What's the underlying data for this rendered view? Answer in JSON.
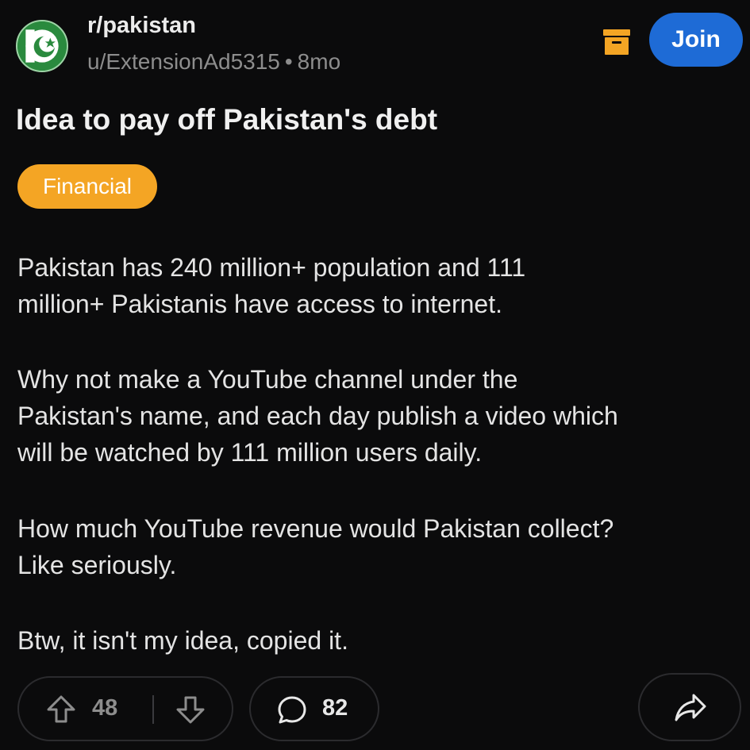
{
  "header": {
    "subreddit": "r/pakistan",
    "author": "u/ExtensionAd5315",
    "separator": "•",
    "age": "8mo",
    "join_label": "Join",
    "avatar_icon": "pakistan-flag-icon",
    "save_icon": "archive-icon"
  },
  "post": {
    "title": "Idea to pay off Pakistan's debt",
    "flair": "Financial",
    "flair_color": "#f4a524",
    "paragraphs": [
      "Pakistan has 240 million+ population and 111\nmillion+ Pakistanis have access to internet.",
      "Why not make a YouTube channel under the\nPakistan's name, and each day publish a video which\nwill be watched by 111 million users daily.",
      "How much YouTube revenue would Pakistan collect?\nLike seriously.",
      "Btw, it isn't my idea, copied it."
    ]
  },
  "actions": {
    "upvotes": "48",
    "comments": "82",
    "upvote_icon": "arrow-up-icon",
    "downvote_icon": "arrow-down-icon",
    "comment_icon": "comment-bubble-icon",
    "share_icon": "share-arrow-icon"
  },
  "colors": {
    "background": "#0b0b0c",
    "join_button": "#1e6bd6",
    "save_icon": "#f4a524",
    "muted_text": "#8d8d8d"
  }
}
